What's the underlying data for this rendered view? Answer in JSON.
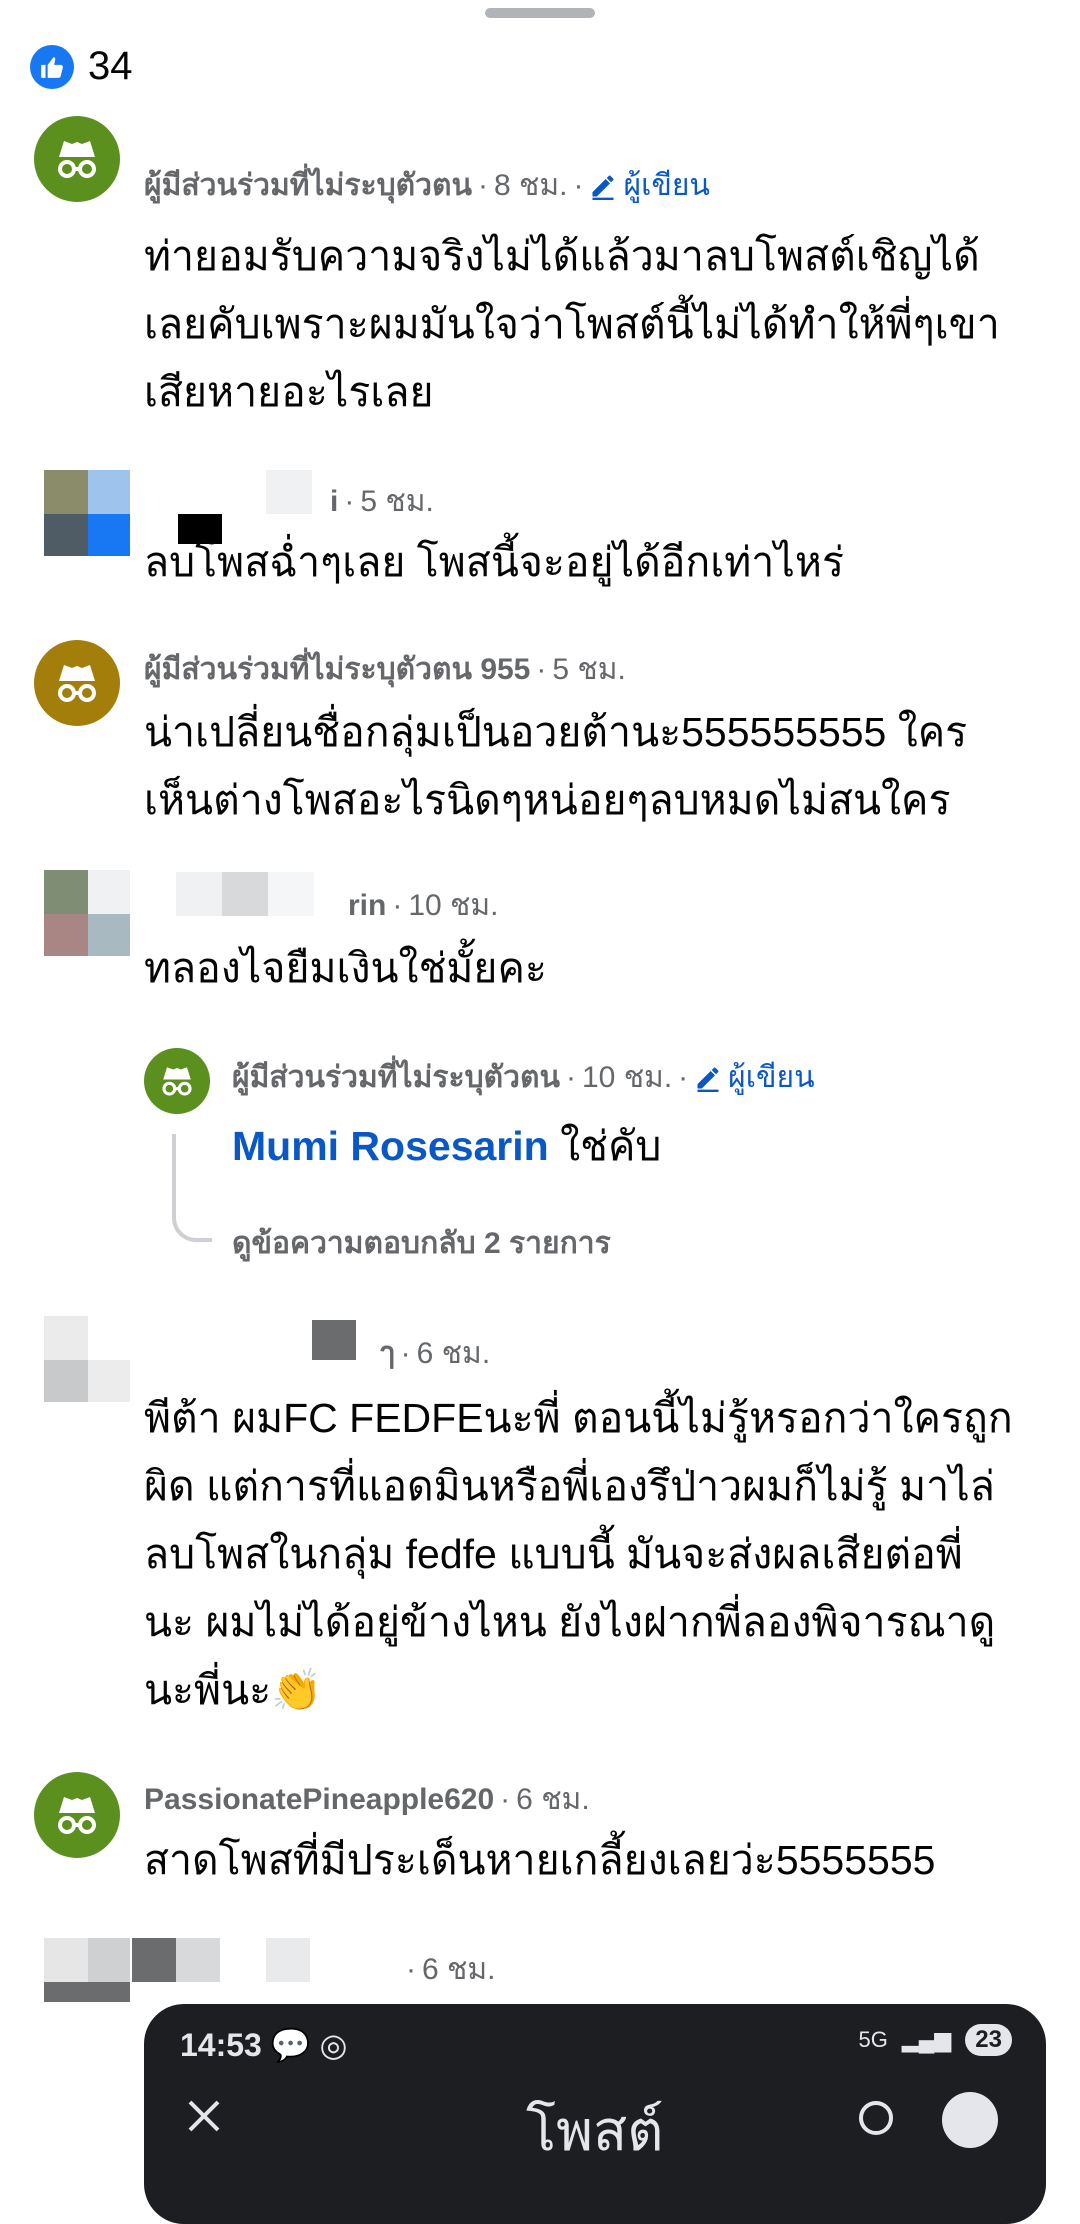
{
  "reactions": {
    "count": "34"
  },
  "comments": [
    {
      "name": "ผู้มีส่วนร่วมที่ไม่ระบุตัวตน",
      "time": "8 ชม.",
      "badge": "ผู้เขียน",
      "lines": [
        "ท่ายอมรับความจริงไม่ได้แล้วมาลบโพสต์เชิญได้",
        "เลยคับเพราะผมมันใจว่าโพสต์นี้ไม่ได้ทำให้พี่ๆเขา",
        "เสียหายอะไรเลย"
      ]
    },
    {
      "name": "i",
      "time": "5 ชม.",
      "lines": [
        "ลบโพสฉ่ำๆเลย โพสนี้จะอยู่ได้อีกเท่าไหร่"
      ]
    },
    {
      "name": "ผู้มีส่วนร่วมที่ไม่ระบุตัวตน 955",
      "time": "5 ชม.",
      "lines": [
        "น่าเปลี่ยนชื่อกลุ่มเป็นอวยต้านะ555555555 ใคร",
        "เห็นต่างโพสอะไรนิดๆหน่อยๆลบหมดไม่สนใคร"
      ]
    },
    {
      "name": "rin",
      "time": "10 ชม.",
      "lines": [
        "ทลองไจยืมเงินใช่มั้ยคะ"
      ]
    },
    {
      "name": "ผู้มีส่วนร่วมที่ไม่ระบุตัวตน",
      "time": "10 ชม.",
      "badge": "ผู้เขียน",
      "mention": "Mumi Rosesarin",
      "text": "ใช่คับ",
      "view_replies": "ดูข้อความตอบกลับ 2 รายการ"
    },
    {
      "name": "ๅ",
      "time": "6 ชม.",
      "lines": [
        "พีต้า ผมFC FEDFEนะพี่ ตอนนี้ไม่รู้หรอกว่าใครถูก",
        "ผิด แต่การที่แอดมินหรือพี่เองรึป่าวผมก็ไม่รู้ มาไล่",
        "ลบโพสในกลุ่ม fedfe แบบนี้ มันจะส่งผลเสียต่อพี่",
        "นะ ผมไม่ได้อยู่ข้างไหน ยังไงฝากพี่ลองพิจารณาดู",
        "นะพี่นะ👏"
      ]
    },
    {
      "name": "PassionatePineapple620",
      "time": "6 ชม.",
      "lines": [
        "สาดโพสที่มีประเด็นหายเกลี้ยงเลยว่ะ5555555"
      ]
    },
    {
      "name": "",
      "time": "6 ชม."
    }
  ],
  "embedded_screenshot": {
    "time": "14:53",
    "title": "โพสต์",
    "battery": "23",
    "network": "5G"
  },
  "colors": {
    "link": "#0a58c6",
    "anon_green": "#5b8f1e",
    "anon_gold": "#a37e0b",
    "meta": "#65676b"
  }
}
